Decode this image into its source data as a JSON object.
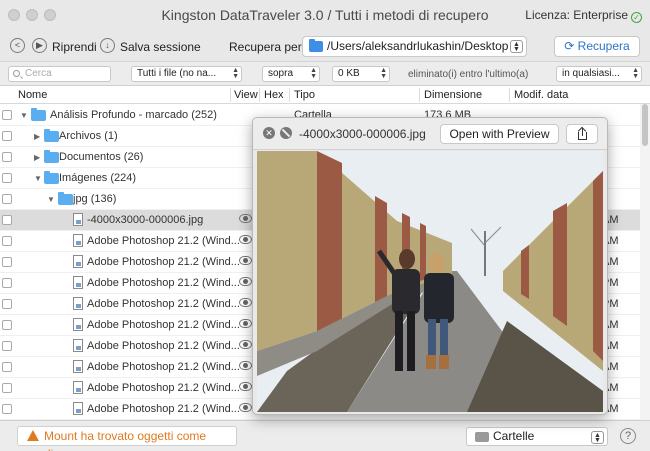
{
  "window": {
    "title": "Kingston DataTraveler 3.0 / Tutti i metodi di recupero",
    "license": "Licenza: Enterprise"
  },
  "toolbar": {
    "resume_label": "Riprendi",
    "save_session_label": "Salva sessione",
    "recover_to_label": "Recupera per:",
    "path_value": "/Users/aleksandrlukashin/Desktop",
    "recover_button": "Recupera"
  },
  "filters": {
    "search_placeholder": "Cerca",
    "file_types": "Tutti i file (no na...",
    "size_comparator": "sopra",
    "size_value": "0 KB",
    "deleted_label": "eliminato(i) entro l'ultimo(a)",
    "time_value": "in qualsiasi..."
  },
  "table": {
    "columns": {
      "name": "Nome",
      "view": "View",
      "hex": "Hex",
      "type": "Tipo",
      "size": "Dimensione",
      "modified": "Modif. data"
    },
    "rows": [
      {
        "name": "Análisis Profundo - marcado (252)",
        "type": "Cartella",
        "size": "173,6 MB",
        "date": ""
      },
      {
        "name": "Archivos (1)",
        "type": "",
        "size": "",
        "date": ""
      },
      {
        "name": "Documentos (26)",
        "type": "",
        "size": "",
        "date": ""
      },
      {
        "name": "Imágenes (224)",
        "type": "",
        "size": "",
        "date": ""
      },
      {
        "name": "jpg (136)",
        "type": "",
        "size": "",
        "date": ""
      },
      {
        "name": "-4000x3000-000006.jpg",
        "date": "AM"
      },
      {
        "name": "Adobe Photoshop 21.2 (Wind...",
        "date": "AM"
      },
      {
        "name": "Adobe Photoshop 21.2 (Wind...",
        "date": "AM"
      },
      {
        "name": "Adobe Photoshop 21.2 (Wind...",
        "date": "PM"
      },
      {
        "name": "Adobe Photoshop 21.2 (Wind...",
        "date": "PM"
      },
      {
        "name": "Adobe Photoshop 21.2 (Wind...",
        "date": "AM"
      },
      {
        "name": "Adobe Photoshop 21.2 (Wind...",
        "date": "AM"
      },
      {
        "name": "Adobe Photoshop 21.2 (Wind...",
        "date": "AM"
      },
      {
        "name": "Adobe Photoshop 21.2 (Wind...",
        "date": "AM"
      },
      {
        "name": "Adobe Photoshop 21.2 (Wind...",
        "date": "AM"
      },
      {
        "name": "Adobe Photoshop 21.2 (Wind...",
        "date": "AM"
      }
    ]
  },
  "quicklook": {
    "filename": "-4000x3000-000006.jpg",
    "open_button": "Open with Preview"
  },
  "bottom": {
    "mount_button": "Mount ha trovato oggetti come disco",
    "view_select": "Cartelle",
    "help": "?"
  },
  "colors": {
    "accent": "#2a74c9",
    "folder": "#5aaef0",
    "warning": "#e07a1f"
  }
}
